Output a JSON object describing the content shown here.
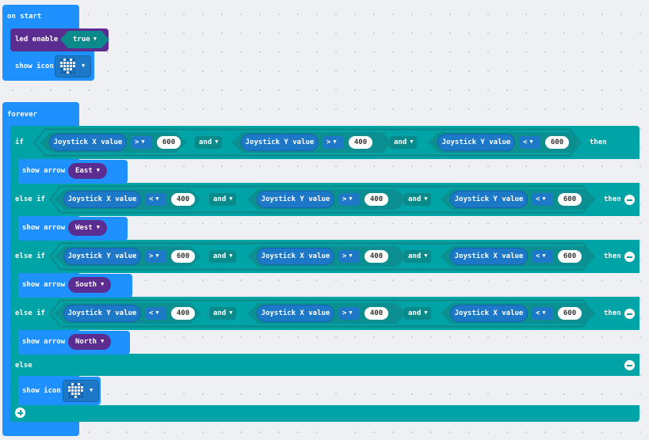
{
  "on_start": {
    "label": "on start",
    "led_enable_label": "led enable",
    "led_enable_value": "true",
    "show_icon_label": "show icon",
    "icon_name": "small-heart-icon"
  },
  "forever": {
    "label": "forever",
    "if_label": "if",
    "else_if_label": "else if",
    "then_label": "then",
    "else_label": "else",
    "and_label": "and",
    "joystick_x": "Joystick X value",
    "joystick_y": "Joystick Y value",
    "show_arrow_label": "show arrow",
    "show_icon_label": "show icon",
    "branches": [
      {
        "c1": "Joystick X value",
        "op1": ">",
        "v1": "600",
        "c2": "Joystick Y value",
        "op2": ">",
        "v2": "400",
        "c3": "Joystick Y value",
        "op3": "<",
        "v3": "600",
        "dir": "East"
      },
      {
        "c1": "Joystick X value",
        "op1": "<",
        "v1": "400",
        "c2": "Joystick Y value",
        "op2": ">",
        "v2": "400",
        "c3": "Joystick Y value",
        "op3": "<",
        "v3": "600",
        "dir": "West"
      },
      {
        "c1": "Joystick Y value",
        "op1": ">",
        "v1": "600",
        "c2": "Joystick X value",
        "op2": ">",
        "v2": "400",
        "c3": "Joystick X value",
        "op3": "<",
        "v3": "600",
        "dir": "South"
      },
      {
        "c1": "Joystick Y value",
        "op1": "<",
        "v1": "400",
        "c2": "Joystick X value",
        "op2": ">",
        "v2": "400",
        "c3": "Joystick X value",
        "op3": "<",
        "v3": "600",
        "dir": "North"
      }
    ],
    "else_icon_name": "small-heart-icon"
  },
  "colors": {
    "event_blue": "#1e90ff",
    "logic_teal": "#00a4a6",
    "led_purple": "#5c2d91",
    "workspace": "#eef0f4"
  }
}
